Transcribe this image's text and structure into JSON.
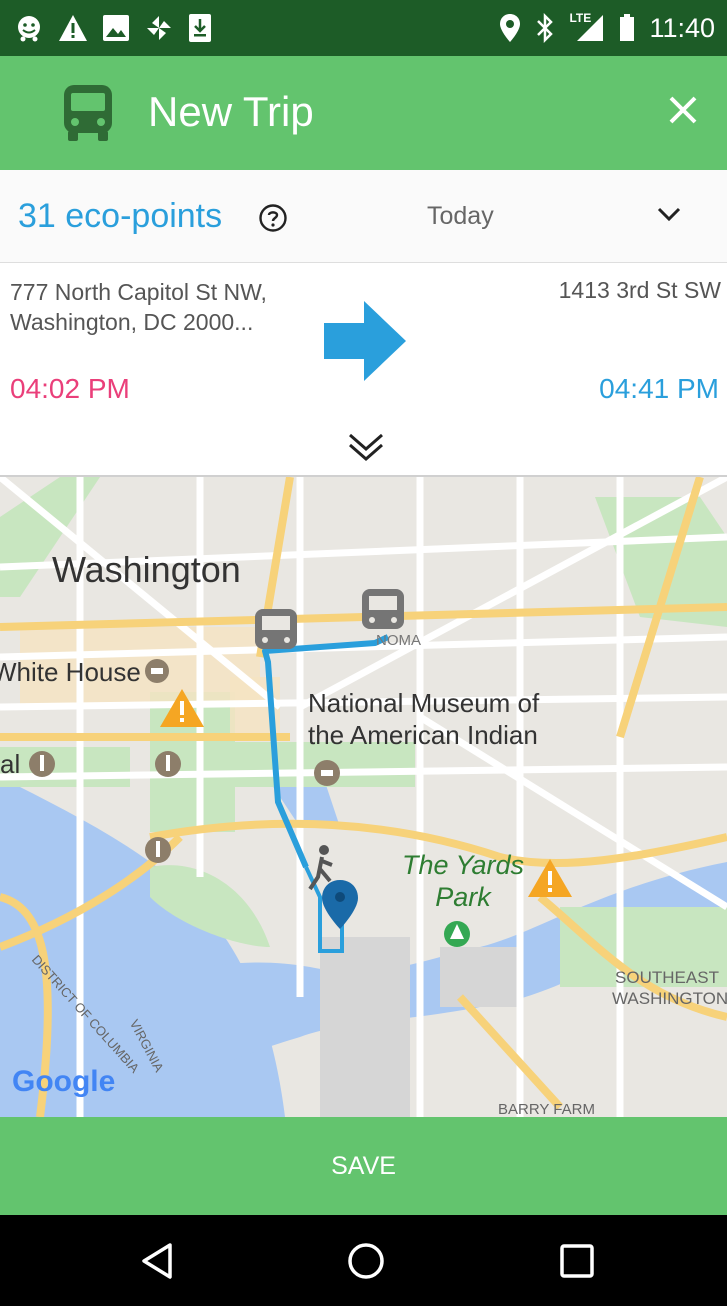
{
  "status_bar": {
    "time": "11:40",
    "network_label": "LTE",
    "left_icons": [
      "waze-icon",
      "warning-icon",
      "image-icon",
      "pinwheel-icon",
      "download-icon"
    ],
    "right_icons": [
      "location-icon",
      "bluetooth-icon",
      "signal-icon",
      "battery-icon"
    ]
  },
  "app_bar": {
    "title": "New Trip",
    "background_color": "#63c46e"
  },
  "eco": {
    "points_label": "31 eco-points",
    "date_label": "Today"
  },
  "trip": {
    "from_address": "777 North Capitol St NW, Washington, DC 2000...",
    "to_address": "1413 3rd St SW",
    "departure_time": "04:02 PM",
    "arrival_time": "04:41 PM"
  },
  "map": {
    "labels": {
      "city": "Washington",
      "white_house": "White House",
      "museum": "National Museum of the American Indian",
      "park": "The Yards Park",
      "noma": "NOMA",
      "southeast": "SOUTHEAST WASHINGTON",
      "barry_farm": "BARRY FARM",
      "district": "DISTRICT OF COLUMBIA",
      "virginia": "VIRGINIA",
      "mall_fragment": "al",
      "logo": "Google"
    },
    "route_color": "#2a9fdc"
  },
  "actions": {
    "save_label": "SAVE"
  }
}
